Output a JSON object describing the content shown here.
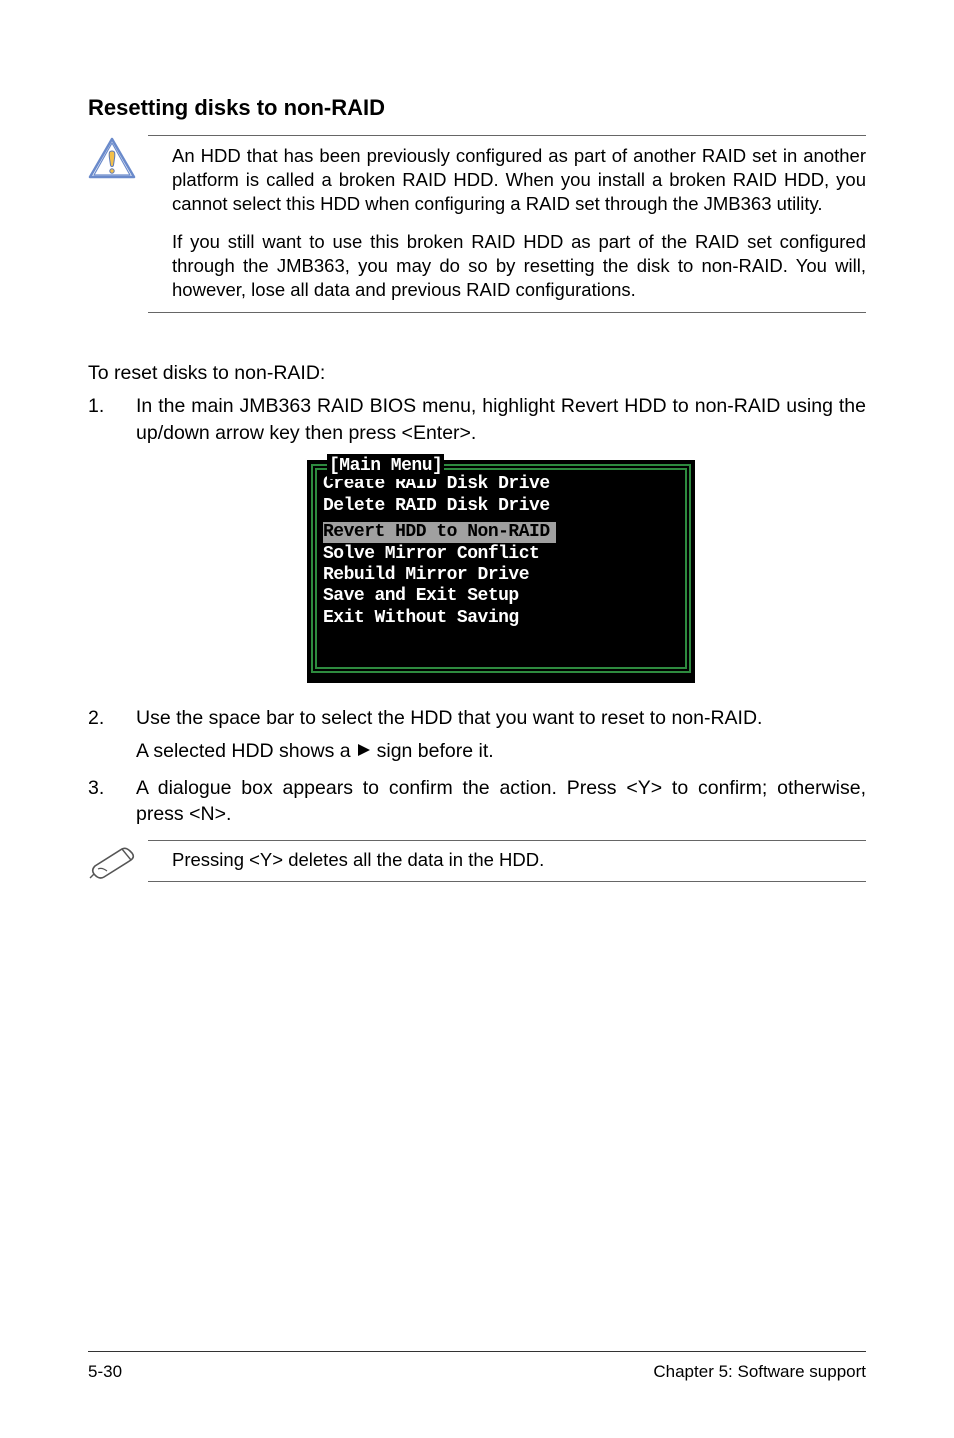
{
  "heading": "Resetting disks to non-RAID",
  "warning": {
    "p1": "An HDD that has been previously configured as part of another RAID set in another platform is called a broken RAID HDD. When you install a broken RAID HDD, you cannot select this HDD when configuring a RAID set through the JMB363 utility.",
    "p2": "If you still want to use this broken RAID HDD as part of the RAID set configured through the JMB363, you may do so by resetting the disk to non-RAID. You will, however, lose all data and previous RAID configurations."
  },
  "lead": "To reset disks to non-RAID:",
  "steps": {
    "s1": "In the main JMB363 RAID BIOS menu, highlight Revert HDD to non-RAID using the up/down arrow key then press <Enter>.",
    "s2_a": "Use the space bar to select the HDD that you want to reset to non-RAID.",
    "s2_b_pre": "A selected HDD shows a",
    "s2_b_post": "sign before it.",
    "s3": "A dialogue box appears to confirm the action. Press <Y> to confirm; otherwise, press <N>."
  },
  "bios": {
    "legend": "[Main Menu]",
    "items": [
      "Create RAID Disk Drive",
      "Delete RAID Disk Drive",
      "Revert HDD to Non-RAID",
      "Solve Mirror Conflict",
      "Rebuild Mirror Drive",
      "Save and Exit Setup",
      "Exit Without Saving"
    ],
    "selected_index": 2
  },
  "note": "Pressing <Y> deletes all the data in the HDD.",
  "footer": {
    "left": "5-30",
    "right": "Chapter 5: Software support"
  }
}
